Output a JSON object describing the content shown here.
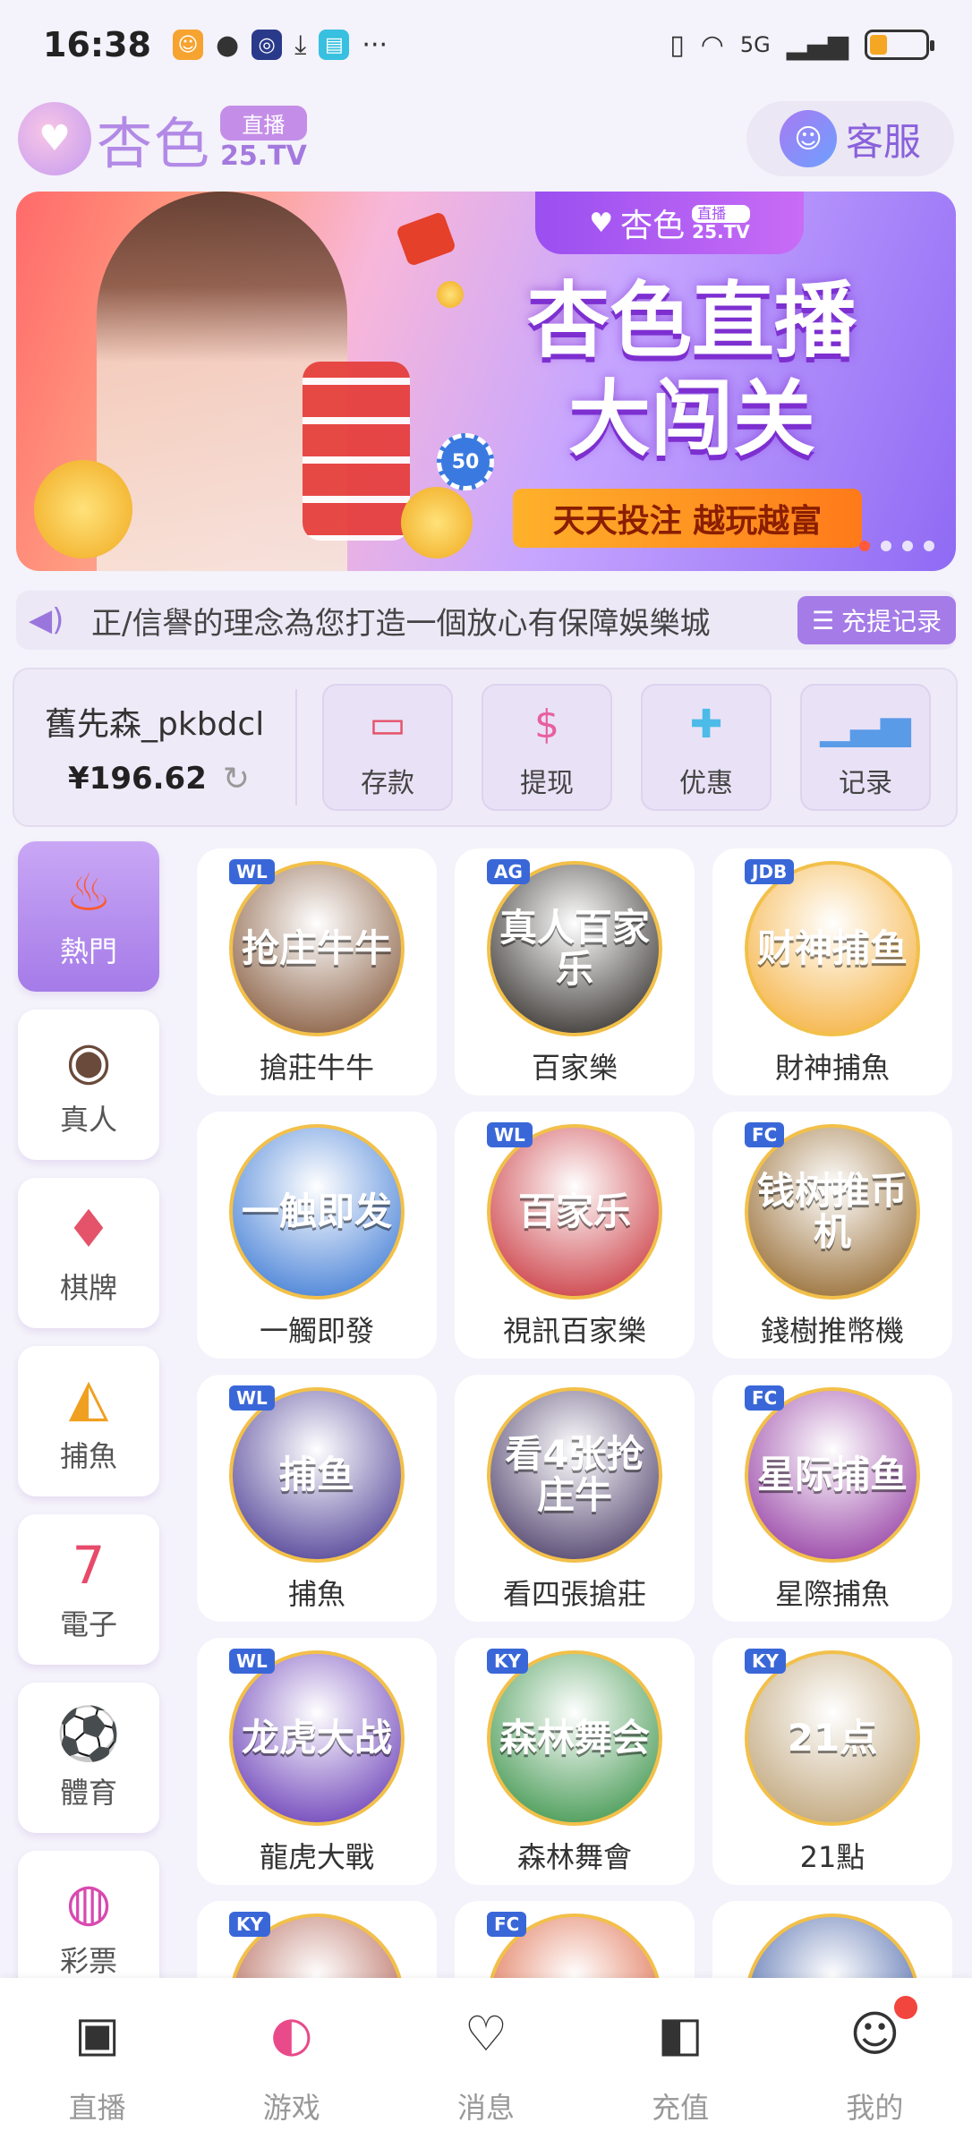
{
  "status_bar": {
    "time": "16:38",
    "network": "5G"
  },
  "header": {
    "logo_text": "杏色",
    "logo_live": "直播",
    "logo_domain": "25.TV",
    "service_label": "客服"
  },
  "banner": {
    "logo_text": "杏色",
    "logo_live": "直播",
    "logo_domain": "25.TV",
    "title_line1": "杏色直播",
    "title_line2": "大闯关",
    "slogan": "天天投注 越玩越富",
    "chip_value": "50"
  },
  "marquee": {
    "text": "正/信譽的理念為您打造一個放心有保障娛樂城",
    "record_label": "充提记录"
  },
  "account": {
    "username": "舊先森_pkbdcl",
    "balance": "¥196.62",
    "actions": [
      {
        "label": "存款",
        "icon": "card-icon"
      },
      {
        "label": "提现",
        "icon": "money-bag-icon"
      },
      {
        "label": "优惠",
        "icon": "gift-icon"
      },
      {
        "label": "记录",
        "icon": "bar-chart-icon"
      }
    ]
  },
  "categories": [
    {
      "label": "熱門",
      "icon": "flame-icon",
      "active": true
    },
    {
      "label": "真人",
      "icon": "poker-chip-icon"
    },
    {
      "label": "棋牌",
      "icon": "playing-card-icon"
    },
    {
      "label": "捕魚",
      "icon": "fish-icon"
    },
    {
      "label": "電子",
      "icon": "slot-machine-icon"
    },
    {
      "label": "體育",
      "icon": "soccer-ball-icon"
    },
    {
      "label": "彩票",
      "icon": "lottery-ball-icon"
    }
  ],
  "games": [
    {
      "name": "搶莊牛牛",
      "art_text": "抢庄牛牛",
      "provider": "WL",
      "color": "#7a4a2a"
    },
    {
      "name": "百家樂",
      "art_text": "真人百家乐",
      "provider": "AG",
      "color": "#1e1a16"
    },
    {
      "name": "財神捕魚",
      "art_text": "财神捕鱼",
      "provider": "JDB",
      "color": "#f4a92c"
    },
    {
      "name": "一觸即發",
      "art_text": "一触即发",
      "provider": "",
      "color": "#2d6fd1"
    },
    {
      "name": "視訊百家樂",
      "art_text": "百家乐",
      "provider": "WL",
      "color": "#c4242c"
    },
    {
      "name": "錢樹推幣機",
      "art_text": "钱树推币机",
      "provider": "FC",
      "color": "#8a5a1a"
    },
    {
      "name": "捕魚",
      "art_text": "捕鱼",
      "provider": "WL",
      "color": "#3b2a8a"
    },
    {
      "name": "看四張搶莊",
      "art_text": "看4张抢庄牛",
      "provider": "",
      "color": "#3a2a5a"
    },
    {
      "name": "星際捕魚",
      "art_text": "星际捕鱼",
      "provider": "FC",
      "color": "#8a2a9a"
    },
    {
      "name": "龍虎大戰",
      "art_text": "龙虎大战",
      "provider": "WL",
      "color": "#5a2ab0"
    },
    {
      "name": "森林舞會",
      "art_text": "森林舞会",
      "provider": "KY",
      "color": "#2a8a3a"
    },
    {
      "name": "21點",
      "art_text": "21点",
      "provider": "KY",
      "color": "#b89a6a"
    },
    {
      "name": "",
      "art_text": "",
      "provider": "KY",
      "color": "#a64a3a"
    },
    {
      "name": "",
      "art_text": "",
      "provider": "FC",
      "color": "#d8502a"
    },
    {
      "name": "",
      "art_text": "",
      "provider": "",
      "color": "#2a4a9a"
    }
  ],
  "bottom_nav": [
    {
      "label": "直播",
      "icon": "camera-icon"
    },
    {
      "label": "游戏",
      "icon": "gamepad-icon"
    },
    {
      "label": "消息",
      "icon": "chat-icon"
    },
    {
      "label": "充值",
      "icon": "wallet-icon"
    },
    {
      "label": "我的",
      "icon": "smile-icon",
      "badge": true
    }
  ],
  "colors": {
    "accent": "#a57be8",
    "background": "#f4f2fa"
  }
}
